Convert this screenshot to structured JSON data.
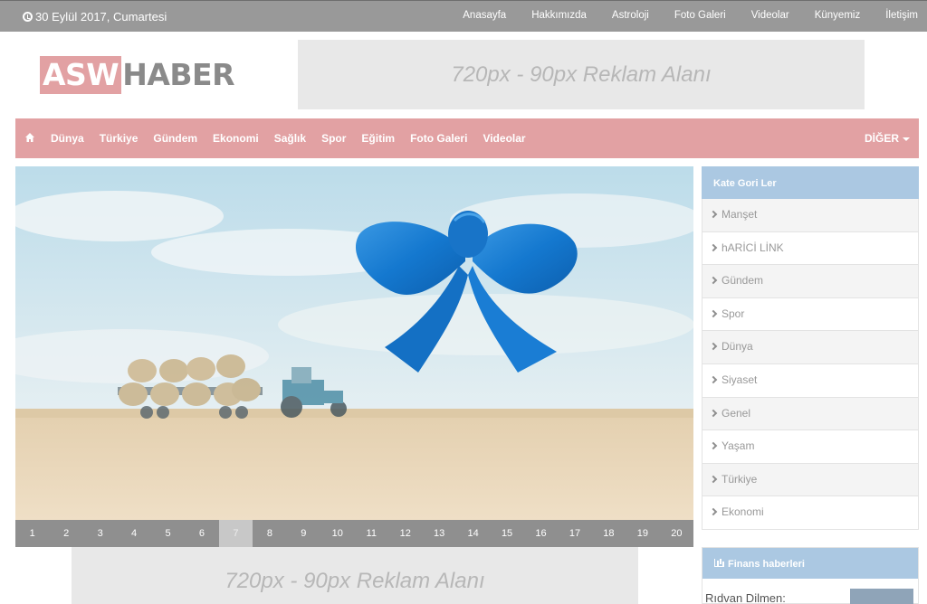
{
  "topbar": {
    "date": "30 Eylül 2017, Cumartesi",
    "links": [
      "Anasayfa",
      "Hakkımızda",
      "Astroloji",
      "Foto Galeri",
      "Videolar",
      "Künyemiz",
      "İletişim"
    ]
  },
  "logo": {
    "part1": "ASW",
    "part2": "HABER"
  },
  "ads": {
    "top": "720px - 90px  Reklam Alanı",
    "bottom": "720px - 90px  Reklam Alanı"
  },
  "mainnav": {
    "items": [
      "Dünya",
      "Türkiye",
      "Gündem",
      "Ekonomi",
      "Sağlık",
      "Spor",
      "Eğitim",
      "Foto Galeri",
      "Videolar"
    ],
    "more": "DİĞER"
  },
  "slider": {
    "pages": [
      "1",
      "2",
      "3",
      "4",
      "5",
      "6",
      "7",
      "8",
      "9",
      "10",
      "11",
      "12",
      "13",
      "14",
      "15",
      "16",
      "17",
      "18",
      "19",
      "20"
    ],
    "active_page": "7"
  },
  "sidebar": {
    "categories_title": "Kate Gori Ler",
    "categories": [
      "Manşet",
      "hARİCİ LİNK",
      "Gündem",
      "Spor",
      "Dünya",
      "Siyaset",
      "Genel",
      "Yaşam",
      "Türkiye",
      "Ekonomi"
    ],
    "finance_title": "Finans haberleri",
    "finance_news": "Rıdvan Dilmen:"
  },
  "colors": {
    "accent": "#e2a1a3",
    "topbar": "#999999",
    "sidebar_header": "#abc8e2",
    "ribbon": "#1a7fd0"
  },
  "icons": [
    "clock-icon",
    "home-icon",
    "caret-down-icon",
    "chevron-right-icon",
    "bar-chart-icon",
    "ribbon-icon"
  ]
}
